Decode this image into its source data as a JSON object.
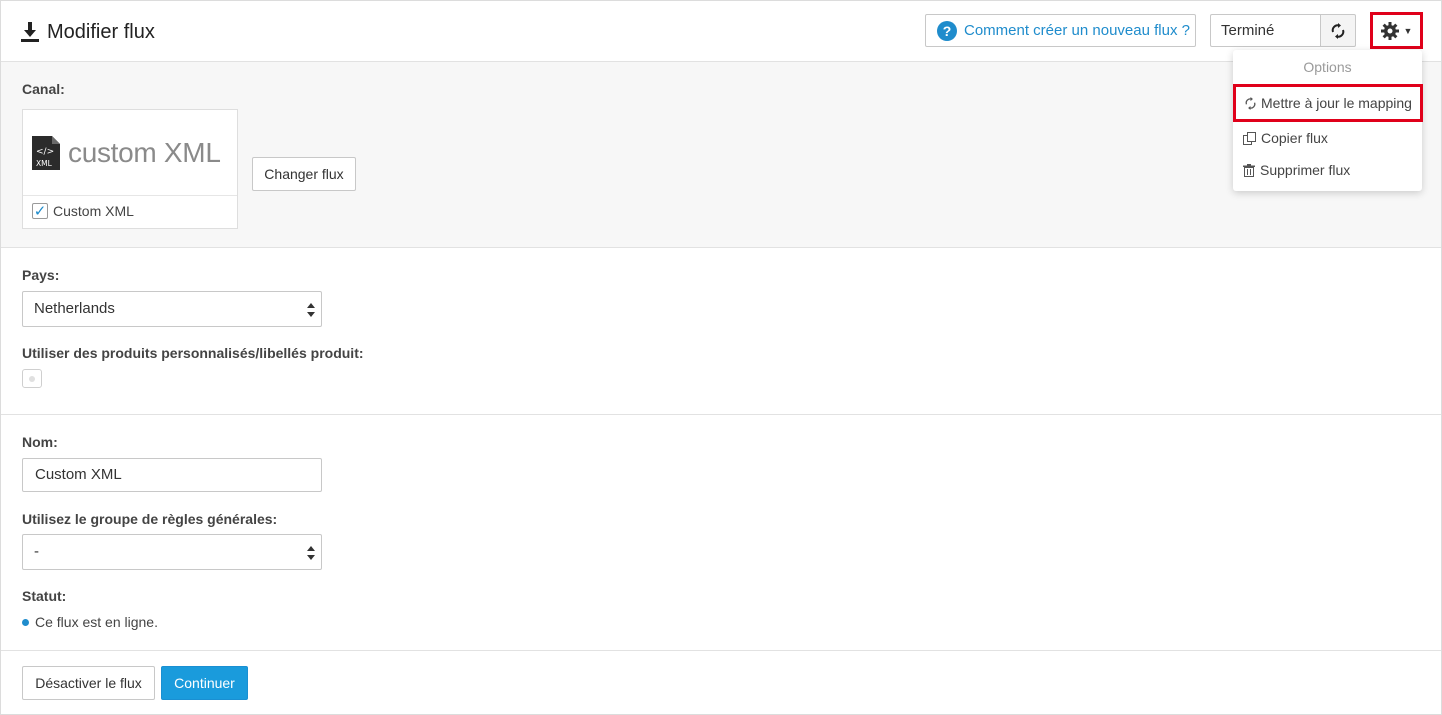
{
  "header": {
    "title": "Modifier flux",
    "help_label": "Comment créer un nouveau flux ?",
    "status_value": "Terminé"
  },
  "dropdown": {
    "header": "Options",
    "items": [
      {
        "label": "Mettre à jour le mapping",
        "icon": "refresh-icon",
        "highlighted": true
      },
      {
        "label": "Copier flux",
        "icon": "copy-icon"
      },
      {
        "label": "Supprimer flux",
        "icon": "trash-icon"
      }
    ]
  },
  "canal": {
    "label": "Canal:",
    "logo_text": "custom XML",
    "file_badge": "XML",
    "checkbox_label": "Custom XML",
    "change_button": "Changer flux"
  },
  "pays": {
    "label": "Pays:",
    "selected": "Netherlands",
    "custom_products_label": "Utiliser des produits personnalisés/libellés produit:"
  },
  "form": {
    "name_label": "Nom:",
    "name_value": "Custom XML",
    "rules_label": "Utilisez le groupe de règles générales:",
    "rules_selected": "-",
    "status_label": "Statut:",
    "status_text": "Ce flux est en ligne."
  },
  "footer": {
    "deactivate_label": "Désactiver le flux",
    "continue_label": "Continuer"
  },
  "colors": {
    "accent": "#1a9bdc",
    "highlight": "#e0001a"
  }
}
